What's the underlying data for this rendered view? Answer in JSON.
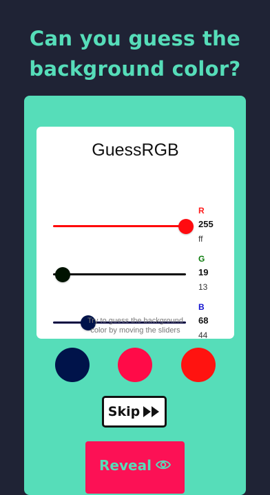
{
  "headline": {
    "line1": "Can you guess the",
    "line2": "background color?"
  },
  "card": {
    "title": "GuessRGB",
    "channels": [
      {
        "letter": "R",
        "value": "255",
        "hex": "ff",
        "level": 1.0,
        "color": "#ff1a1a",
        "track_color": "#ff0000"
      },
      {
        "letter": "G",
        "value": "19",
        "hex": "13",
        "level": 0.0745,
        "color": "#0a7a0a",
        "track_color": "#000000"
      },
      {
        "letter": "B",
        "value": "68",
        "hex": "44",
        "level": 0.2667,
        "color": "#1010d0",
        "track_color": "#00003f"
      }
    ],
    "hint_line1": "Try to guess the background",
    "hint_line2": "color by moving the sliders"
  },
  "swatches": [
    {
      "name": "swatch-navy",
      "color": "#00134a"
    },
    {
      "name": "swatch-crimson",
      "color": "#ff0b48"
    },
    {
      "name": "swatch-red",
      "color": "#ff1310"
    }
  ],
  "colors": {
    "background": "#1f2335",
    "accent": "#56ddb9",
    "reveal": "#fc1155",
    "thumb_r": "#ff0b10",
    "thumb_g": "#001300",
    "thumb_b": "#00134a"
  },
  "buttons": {
    "skip_label": "Skip",
    "skip_icon": "fast-forward-icon",
    "reveal_label": "Reveal",
    "reveal_icon": "eye-icon"
  }
}
